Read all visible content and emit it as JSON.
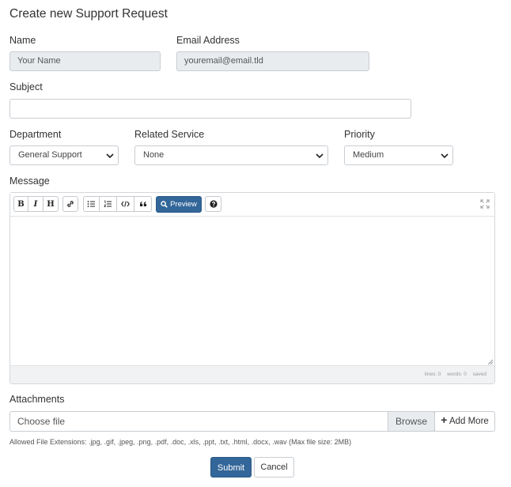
{
  "page": {
    "title": "Create new Support Request"
  },
  "form": {
    "name": {
      "label": "Name",
      "value": "Your Name"
    },
    "email": {
      "label": "Email Address",
      "value": "youremail@email.tld"
    },
    "subject": {
      "label": "Subject",
      "value": ""
    },
    "department": {
      "label": "Department",
      "selected": "General Support"
    },
    "related_service": {
      "label": "Related Service",
      "selected": "None"
    },
    "priority": {
      "label": "Priority",
      "selected": "Medium"
    },
    "message": {
      "label": "Message",
      "toolbar": {
        "bold": "B",
        "italic": "I",
        "heading": "H",
        "preview_label": "Preview"
      },
      "status": {
        "lines": "lines: 0",
        "words": "words: 0",
        "saved": "saved"
      }
    },
    "attachments": {
      "label": "Attachments",
      "placeholder": "Choose file",
      "browse_label": "Browse",
      "add_more_label": "Add More",
      "allowed_text": "Allowed File Extensions: .jpg, .gif, .jpeg, .png, .pdf, .doc, .xls, .ppt, .txt, .html, .docx, .wav (Max file size: 2MB)"
    },
    "buttons": {
      "submit": "Submit",
      "cancel": "Cancel"
    }
  },
  "colors": {
    "primary": "#336699",
    "disabled_bg": "#e9ecef",
    "border": "#c9cdd2"
  }
}
